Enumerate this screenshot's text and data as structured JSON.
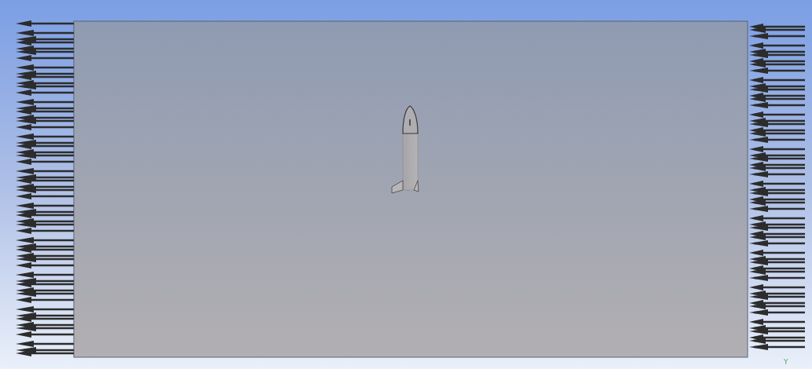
{
  "viewport": {
    "axis_label": "Y"
  }
}
